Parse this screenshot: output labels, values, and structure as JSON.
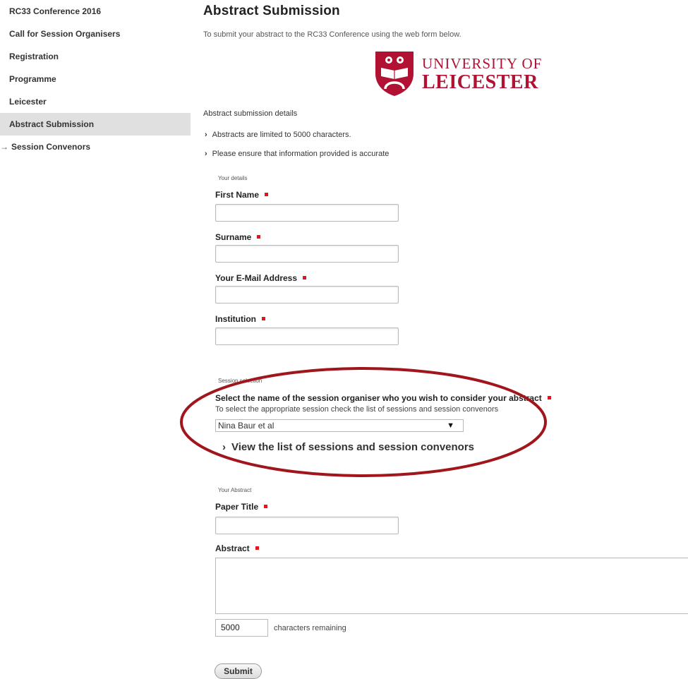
{
  "sidebar": {
    "items": [
      {
        "label": "RC33 Conference 2016"
      },
      {
        "label": "Call for Session Organisers"
      },
      {
        "label": "Registration"
      },
      {
        "label": "Programme"
      },
      {
        "label": "Leicester"
      },
      {
        "label": "Abstract Submission"
      },
      {
        "label": "Session Convenors",
        "arrow": "→"
      }
    ]
  },
  "main": {
    "title": "Abstract Submission",
    "intro": "To submit your abstract to the RC33 Conference using the web form below.",
    "logo": {
      "line1": "UNIVERSITY OF",
      "line2": "LEICESTER",
      "color": "#b11233"
    },
    "details_heading": "Abstract submission details",
    "bullets": [
      "Abstracts are limited to 5000 characters.",
      "Please ensure that information provided is accurate"
    ],
    "your_details_legend": "Your details",
    "fields": {
      "first_name": "First Name",
      "surname": "Surname",
      "email": "Your E-Mail Address",
      "institution": "Institution"
    },
    "session_legend": "Session selection",
    "session_select_label": "Select the name of the session organiser who you wish to consider your abstract",
    "session_help": "To select the appropriate session check the list of sessions and session convenors",
    "session_selected": "Nina Baur et al",
    "view_link": "View the list of sessions and session convenors",
    "your_abstract_legend": "Your Abstract",
    "paper_title_label": "Paper Title",
    "abstract_label": "Abstract",
    "chars_remaining_value": "5000",
    "chars_remaining_label": "characters remaining",
    "submit_label": "Submit"
  },
  "colors": {
    "required_marker": "#e4141e",
    "annotation_ellipse": "#a0161c",
    "active_nav_bg": "#e0e0e0"
  }
}
